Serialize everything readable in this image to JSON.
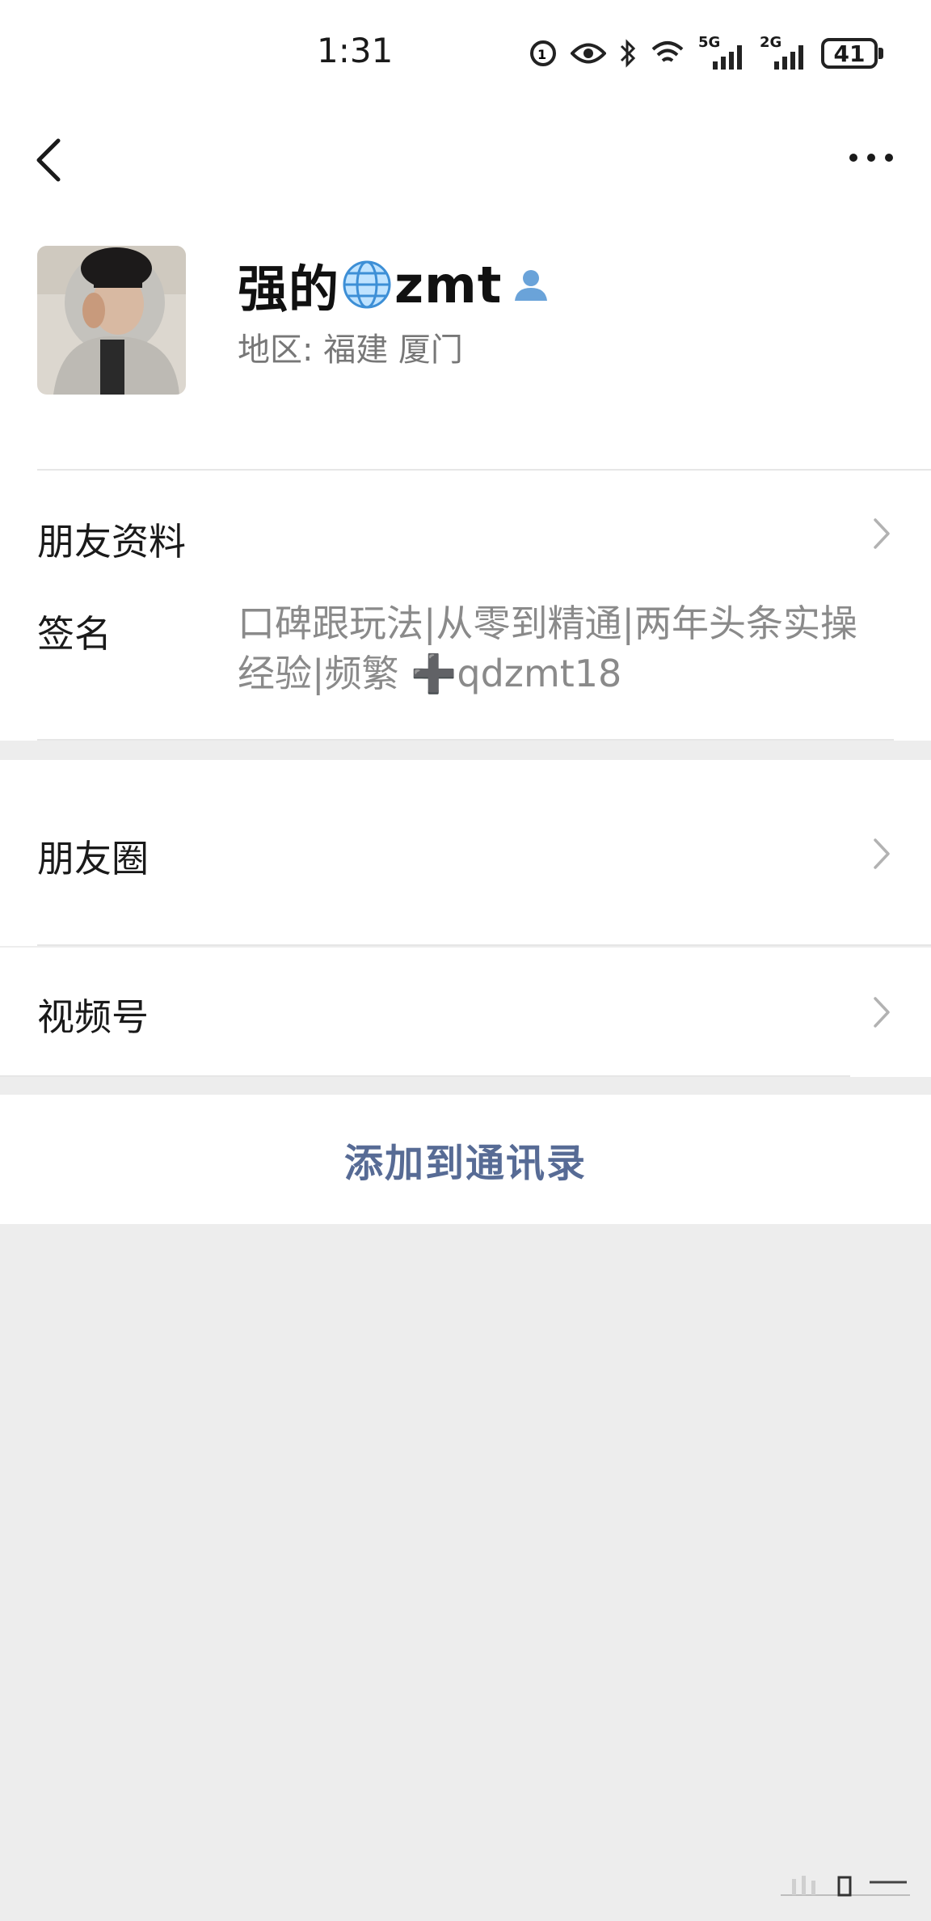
{
  "status_bar": {
    "time": "1:31",
    "network_5g": "5G",
    "network_2g": "2G",
    "battery": "41"
  },
  "nav": {
    "back_icon": "chevron-left-icon",
    "more_icon": "more-dots-icon"
  },
  "profile": {
    "name": "强的",
    "name_suffix": "zmt",
    "globe_icon": "globe-icon",
    "gender_icon": "person-icon",
    "region": "地区:  福建  厦门"
  },
  "info": {
    "friend_profile_label": "朋友资料",
    "signature_label": "签名",
    "signature_text": "口碑跟玩法|从零到精通|两年头条实操经验|频繁 ➕qdzmt18"
  },
  "moments_label": "朋友圈",
  "channels_label": "视频号",
  "add_contact_label": "添加到通讯录",
  "colors": {
    "link_blue": "#576b95",
    "background": "#ededed"
  }
}
